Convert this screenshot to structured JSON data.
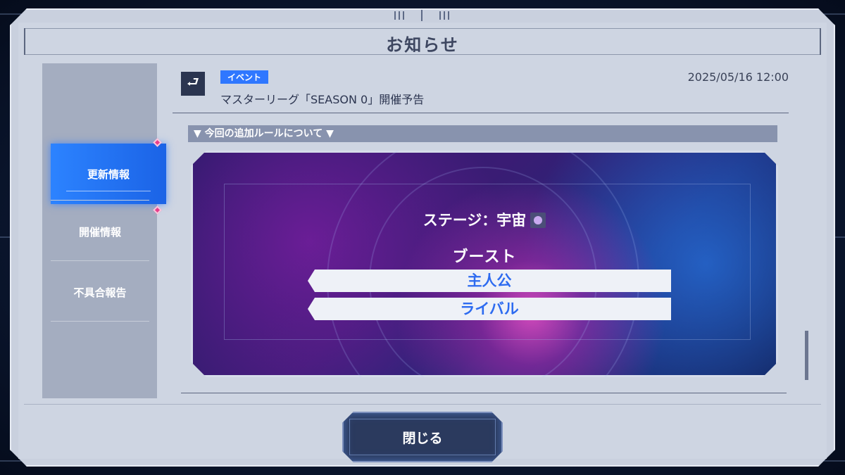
{
  "window": {
    "title": "お知らせ"
  },
  "sidebar": {
    "items": [
      {
        "label": "更新情報",
        "active": true,
        "has_badge": true
      },
      {
        "label": "開催情報",
        "active": false,
        "has_badge": true
      },
      {
        "label": "不具合報告",
        "active": false,
        "has_badge": false
      }
    ]
  },
  "news": {
    "icon": "return-arrow-icon",
    "tag": "イベント",
    "title": "マスターリーグ「SEASON 0」開催予告",
    "date": "2025/05/16 12:00",
    "section_heading": "▼ 今回の追加ルールについて ▼"
  },
  "banner": {
    "stage_label": "ステージ：宇宙",
    "stage_icon": "planet-icon",
    "boost_label": "ブースト",
    "boost_targets": [
      "主人公",
      "ライバル"
    ]
  },
  "footer": {
    "close_label": "閉じる"
  },
  "colors": {
    "accent": "#2f77ff",
    "badge": "#e83e8c",
    "panel": "#ced5e2"
  }
}
